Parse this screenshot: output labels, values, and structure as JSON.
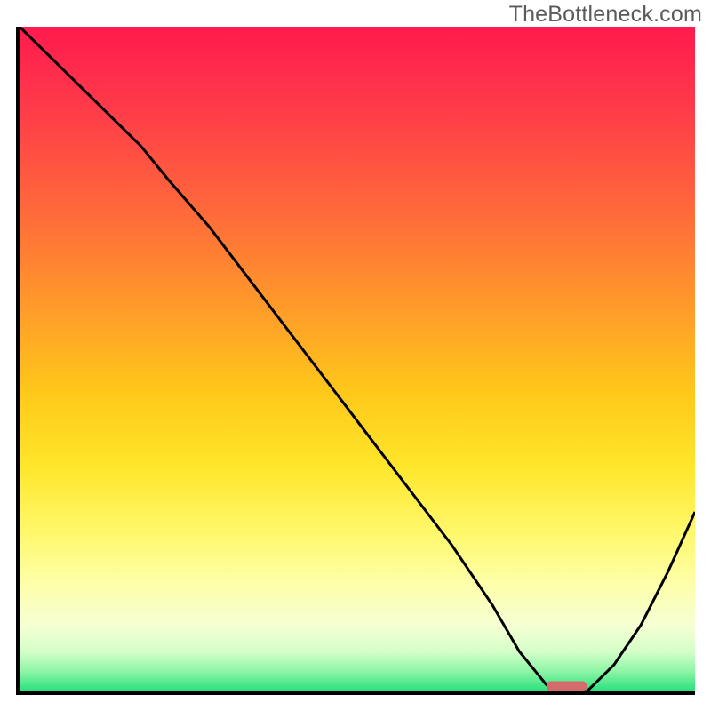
{
  "watermark": "TheBottleneck.com",
  "chart_data": {
    "type": "line",
    "title": "",
    "xlabel": "",
    "ylabel": "",
    "xlim": [
      0,
      100
    ],
    "ylim": [
      0,
      100
    ],
    "grid": false,
    "legend": false,
    "background_gradient": {
      "direction": "vertical",
      "stops": [
        {
          "t": 0.0,
          "color": "#ff1a4d"
        },
        {
          "t": 0.12,
          "color": "#ff3a4a"
        },
        {
          "t": 0.28,
          "color": "#ff6a3a"
        },
        {
          "t": 0.42,
          "color": "#ff9a2a"
        },
        {
          "t": 0.55,
          "color": "#ffc81a"
        },
        {
          "t": 0.66,
          "color": "#ffe62a"
        },
        {
          "t": 0.76,
          "color": "#fff86a"
        },
        {
          "t": 0.84,
          "color": "#fdffab"
        },
        {
          "t": 0.9,
          "color": "#f6ffd2"
        },
        {
          "t": 0.94,
          "color": "#d4ffc8"
        },
        {
          "t": 0.97,
          "color": "#8cf5a6"
        },
        {
          "t": 1.0,
          "color": "#28e07c"
        }
      ]
    },
    "series": [
      {
        "name": "bottleneck-curve",
        "color": "#000000",
        "x": [
          0,
          6,
          12,
          18,
          22,
          28,
          34,
          40,
          46,
          52,
          58,
          64,
          70,
          74,
          78,
          82,
          84,
          88,
          92,
          96,
          100
        ],
        "y": [
          100,
          94,
          88,
          82,
          77,
          70,
          62,
          54,
          46,
          38,
          30,
          22,
          13,
          6,
          1,
          0,
          0,
          4,
          10,
          18,
          27
        ]
      }
    ],
    "annotations": [
      {
        "name": "trough-marker",
        "shape": "rounded-rect",
        "x_range": [
          78,
          84
        ],
        "y": 0.8,
        "color": "#d46a6a"
      }
    ]
  }
}
